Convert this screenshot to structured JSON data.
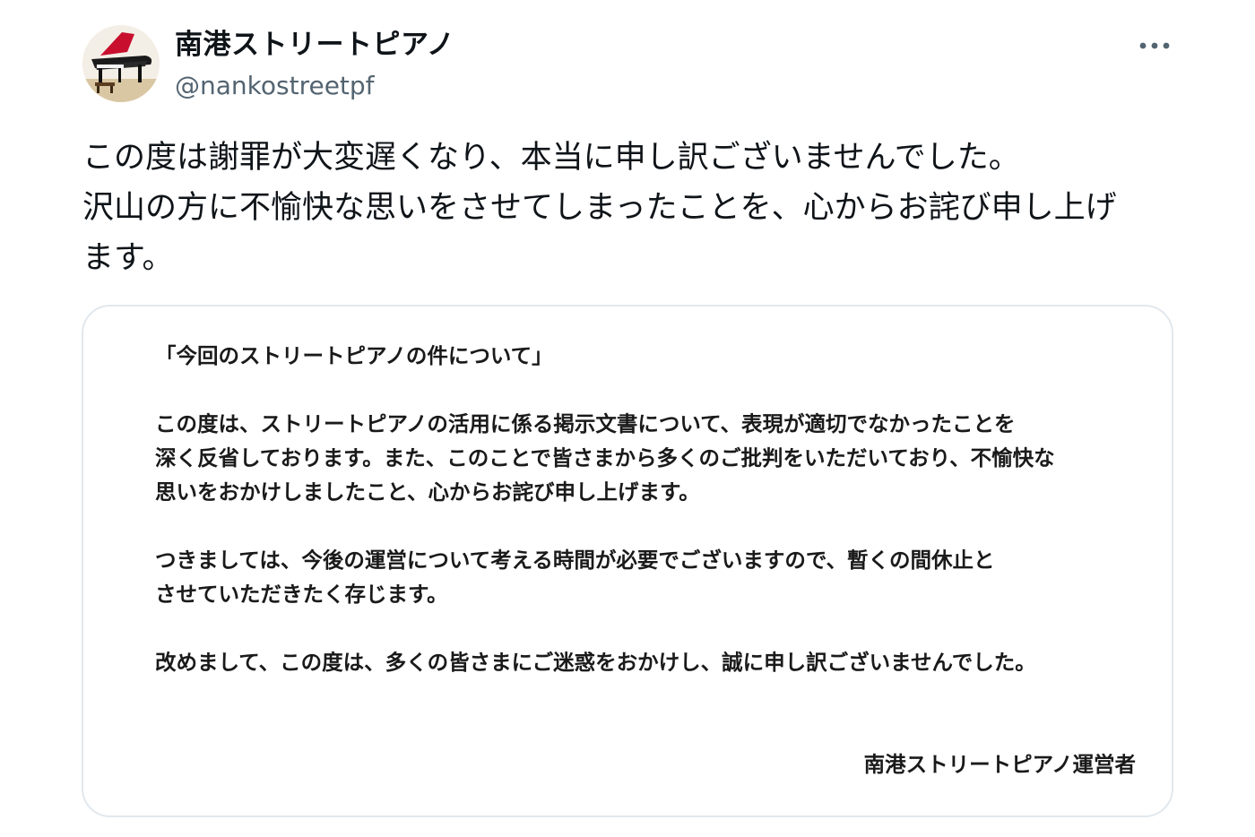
{
  "account": {
    "display_name": "南港ストリートピアノ",
    "handle": "@nankostreetpf",
    "avatar_icon": "grand-piano-icon"
  },
  "menu": {
    "more_icon": "more-horizontal-icon"
  },
  "tweet": {
    "lines": [
      "この度は謝罪が大変遅くなり、本当に申し訳ございませんでした。",
      "沢山の方に不愉快な思いをさせてしまったことを、心からお詫び申し上げ",
      "ます。"
    ]
  },
  "attached_notice": {
    "title": "「今回のストリートピアノの件について」",
    "paragraph1": [
      "この度は、ストリートピアノの活用に係る掲示文書について、表現が適切でなかったことを",
      "深く反省しております。また、このことで皆さまから多くのご批判をいただいており、不愉快な",
      "思いをおかけしましたこと、心からお詫び申し上げます。"
    ],
    "paragraph2": [
      "つきましては、今後の運営について考える時間が必要でございますので、暫くの間休止と",
      "させていただきたく存じます。"
    ],
    "paragraph3": [
      "改めまして、この度は、多くの皆さまにご迷惑をおかけし、誠に申し訳ございませんでした。"
    ],
    "signature": "南港ストリートピアノ運営者"
  },
  "colors": {
    "text_primary": "#0f1419",
    "text_secondary": "#536471",
    "card_border": "#e1e8ed"
  }
}
